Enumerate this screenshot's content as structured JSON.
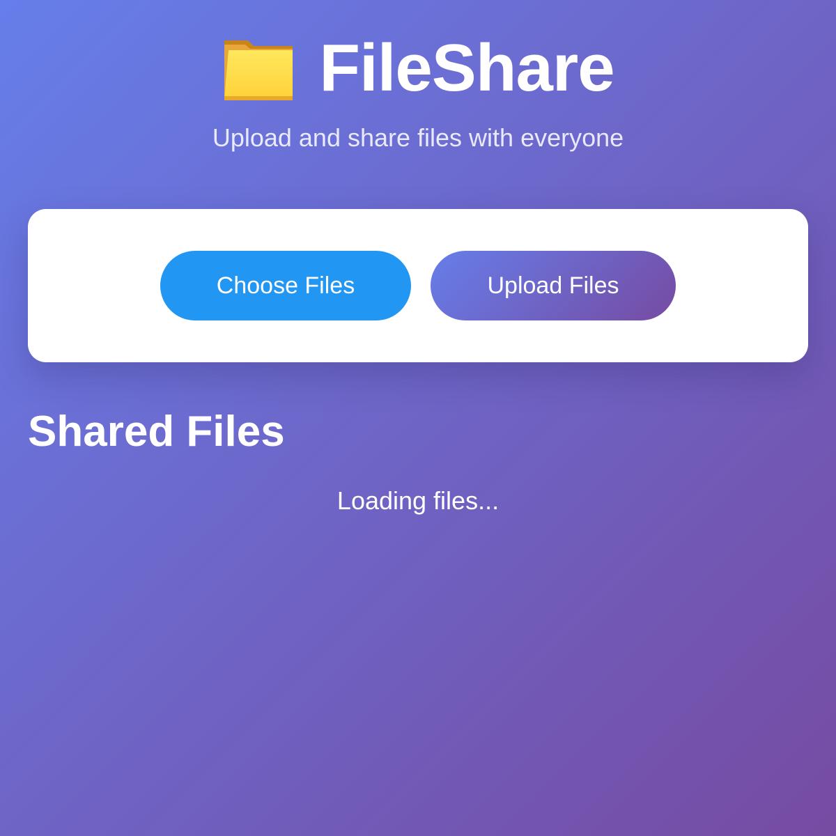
{
  "header": {
    "icon": "folder-icon",
    "title": "FileShare",
    "subtitle": "Upload and share files with everyone"
  },
  "upload_panel": {
    "choose_label": "Choose Files",
    "upload_label": "Upload Files"
  },
  "files_section": {
    "title": "Shared Files",
    "status": "Loading files..."
  },
  "colors": {
    "background_start": "#667eea",
    "background_end": "#764ba2",
    "choose_button": "#2196f3",
    "card": "#ffffff"
  }
}
